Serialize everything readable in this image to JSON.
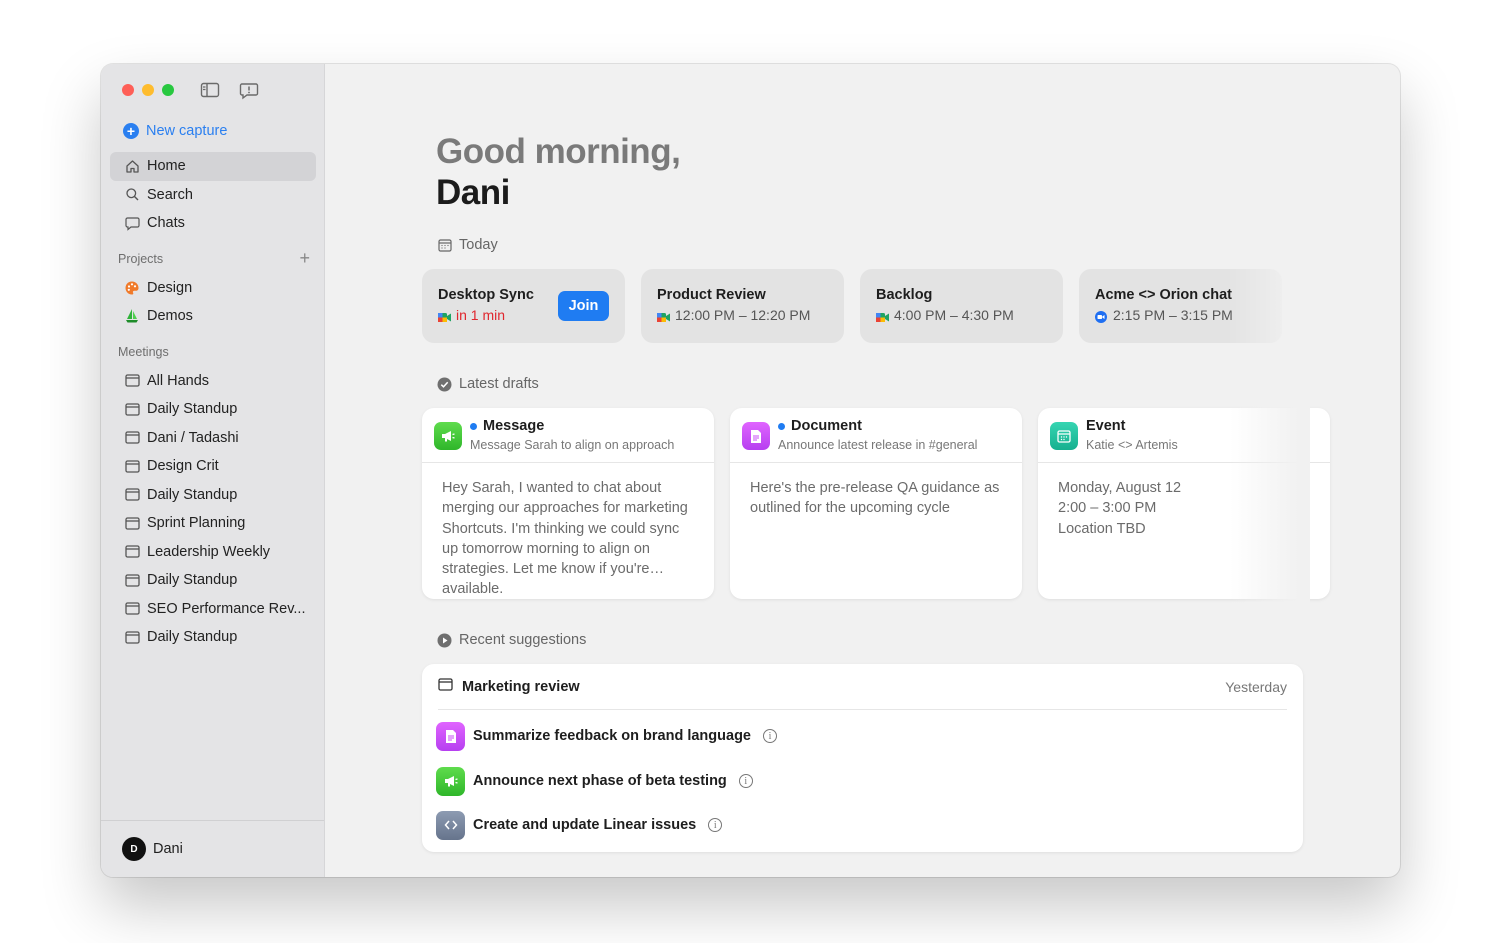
{
  "sidebar": {
    "new_capture": "New capture",
    "nav": [
      {
        "label": "Home",
        "icon": "home-icon"
      },
      {
        "label": "Search",
        "icon": "search-icon"
      },
      {
        "label": "Chats",
        "icon": "chat-bubble-icon"
      }
    ],
    "projects_header": "Projects",
    "projects": [
      {
        "label": "Design",
        "icon": "palette-icon"
      },
      {
        "label": "Demos",
        "icon": "sailboat-icon"
      }
    ],
    "meetings_header": "Meetings",
    "meetings": [
      "All Hands",
      "Daily Standup",
      "Dani / Tadashi",
      "Design Crit",
      "Daily Standup",
      "Sprint Planning",
      "Leadership Weekly",
      "Daily Standup",
      "SEO Performance Rev...",
      "Daily Standup"
    ],
    "user": {
      "initial": "D",
      "name": "Dani"
    }
  },
  "main": {
    "greeting_line1": "Good morning,",
    "greeting_line2": "Dani",
    "today_label": "Today",
    "meetings": [
      {
        "title": "Desktop Sync",
        "time": "in 1 min",
        "urgent": true,
        "join_label": "Join",
        "icon": "google-meet-icon"
      },
      {
        "title": "Product Review",
        "time": "12:00 PM – 12:20 PM",
        "icon": "google-meet-icon"
      },
      {
        "title": "Backlog",
        "time": "4:00 PM – 4:30 PM",
        "icon": "google-meet-icon"
      },
      {
        "title": "Acme <> Orion chat",
        "time": "2:15 PM – 3:15 PM",
        "icon": "zoom-icon"
      }
    ],
    "drafts_label": "Latest drafts",
    "drafts": [
      {
        "type": "Message",
        "subtitle": "Message Sarah to align on approach",
        "body": "Hey Sarah, I wanted to chat about merging our approaches for marketing Shortcuts. I'm thinking we could sync up tomorrow morning to align on strategies. Let me know if you're available.",
        "icon": "megaphone-icon",
        "unread": true
      },
      {
        "type": "Document",
        "subtitle": "Announce latest release in #general",
        "body": "Here's the pre-release QA guidance as outlined for the upcoming cycle",
        "icon": "document-icon",
        "unread": true
      },
      {
        "type": "Event",
        "subtitle": "Katie <> Artemis",
        "body_lines": [
          "Monday, August 12",
          "2:00 – 3:00 PM",
          "Location TBD"
        ],
        "icon": "calendar-icon",
        "unread": false
      }
    ],
    "suggestions_label": "Recent suggestions",
    "suggestion_card": {
      "title": "Marketing review",
      "when": "Yesterday",
      "items": [
        {
          "label": "Summarize feedback on brand language",
          "icon": "document-icon"
        },
        {
          "label": "Announce next phase of beta testing",
          "icon": "megaphone-icon"
        },
        {
          "label": "Create and update Linear issues",
          "icon": "code-icon"
        }
      ]
    }
  },
  "colors": {
    "accent": "#1f7cf2",
    "urgent": "#e0262d",
    "message_green": "#3fc535",
    "document_purple": "#c94cf7",
    "event_teal": "#1fc09d"
  }
}
